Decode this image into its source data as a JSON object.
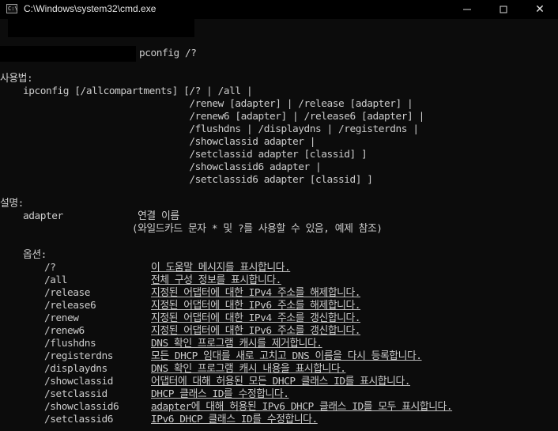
{
  "window": {
    "title": "C:\\Windows\\system32\\cmd.exe",
    "app_icon_glyph": "C:\\",
    "buttons": {
      "minimize": "",
      "maximize": "",
      "close": "✕"
    }
  },
  "console": {
    "command": "pconfig /?",
    "usage": {
      "heading": "사용법:",
      "lines": [
        "    ipconfig [/allcompartments] [/? | /all |",
        "                                 /renew [adapter] | /release [adapter] |",
        "                                 /renew6 [adapter] | /release6 [adapter] |",
        "                                 /flushdns | /displaydns | /registerdns |",
        "                                 /showclassid adapter |",
        "                                 /setclassid adapter [classid] ]",
        "                                 /showclassid6 adapter |",
        "                                 /setclassid6 adapter [classid] ]"
      ]
    },
    "description": {
      "heading": "설명:",
      "lines": [
        "    adapter             연결 이름",
        "                       (와일드카드 문자 * 및 ?를 사용할 수 있음, 예제 참조)"
      ]
    },
    "options": {
      "heading": "    옵션:",
      "items": [
        {
          "flag": "/?",
          "desc": "이 도움말 메시지를 표시합니다."
        },
        {
          "flag": "/all",
          "desc": "전체 구성 정보를 표시합니다."
        },
        {
          "flag": "/release",
          "desc": "지정된 어댑터에 대한 IPv4 주소를 해제합니다."
        },
        {
          "flag": "/release6",
          "desc": "지정된 어댑터에 대한 IPv6 주소를 해제합니다."
        },
        {
          "flag": "/renew",
          "desc": "지정된 어댑터에 대한 IPv4 주소를 갱신합니다."
        },
        {
          "flag": "/renew6",
          "desc": "지정된 어댑터에 대한 IPv6 주소를 갱신합니다."
        },
        {
          "flag": "/flushdns",
          "desc": "DNS 확인 프로그램 캐시를 제거합니다."
        },
        {
          "flag": "/registerdns",
          "desc": "모든 DHCP 임대를 새로 고치고 DNS 이름을 다시 등록합니다."
        },
        {
          "flag": "/displaydns",
          "desc": "DNS 확인 프로그램 캐시 내용을 표시합니다."
        },
        {
          "flag": "/showclassid",
          "desc": "어댑터에 대해 허용된 모든 DHCP 클래스 ID를 표시합니다."
        },
        {
          "flag": "/setclassid",
          "desc": "DHCP 클래스 ID를 수정합니다."
        },
        {
          "flag": "/showclassid6",
          "desc": "adapter에 대해 허용된 IPv6 DHCP 클래스 ID를 모두 표시합니다."
        },
        {
          "flag": "/setclassid6",
          "desc": "IPv6 DHCP 클래스 ID를 수정합니다."
        }
      ]
    }
  }
}
